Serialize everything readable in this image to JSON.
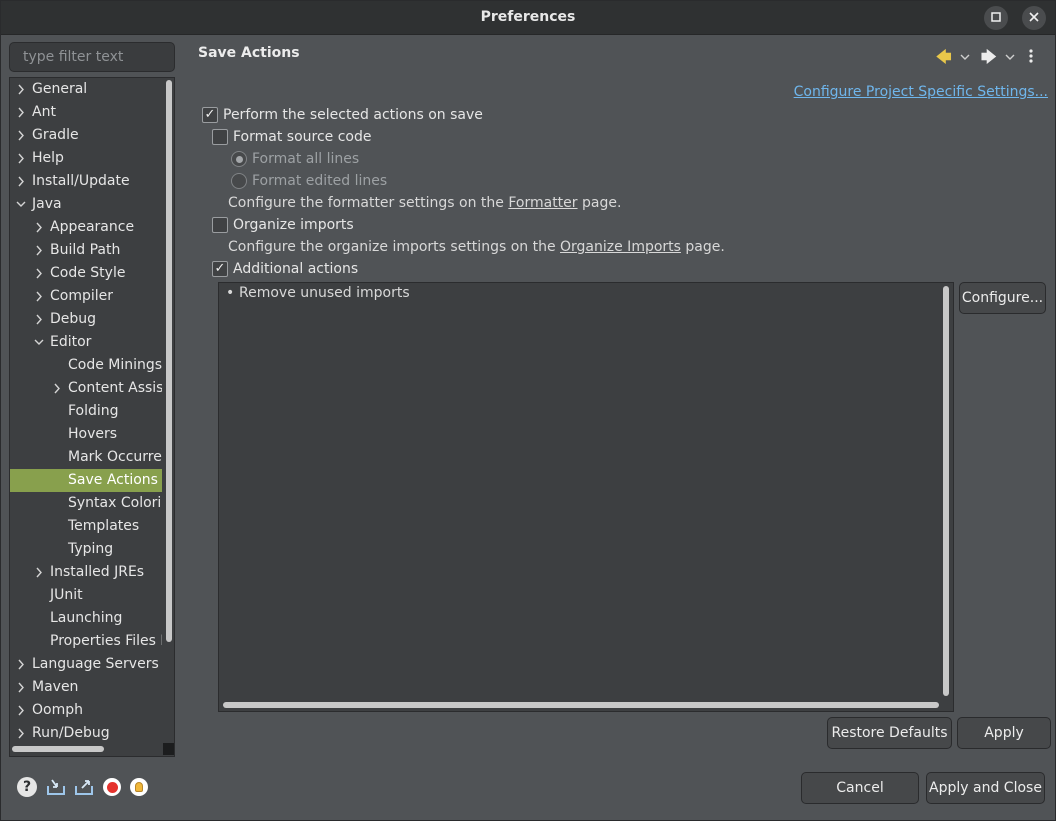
{
  "window": {
    "title": "Preferences",
    "maximize_icon": "maximize-icon",
    "close_icon": "close-icon"
  },
  "filter": {
    "placeholder": "type filter text",
    "value": ""
  },
  "tree": {
    "items": [
      {
        "label": "General",
        "level": 0,
        "expander": "collapsed"
      },
      {
        "label": "Ant",
        "level": 0,
        "expander": "collapsed"
      },
      {
        "label": "Gradle",
        "level": 0,
        "expander": "collapsed"
      },
      {
        "label": "Help",
        "level": 0,
        "expander": "collapsed"
      },
      {
        "label": "Install/Update",
        "level": 0,
        "expander": "collapsed"
      },
      {
        "label": "Java",
        "level": 0,
        "expander": "expanded"
      },
      {
        "label": "Appearance",
        "level": 1,
        "expander": "collapsed"
      },
      {
        "label": "Build Path",
        "level": 1,
        "expander": "collapsed"
      },
      {
        "label": "Code Style",
        "level": 1,
        "expander": "collapsed"
      },
      {
        "label": "Compiler",
        "level": 1,
        "expander": "collapsed"
      },
      {
        "label": "Debug",
        "level": 1,
        "expander": "collapsed"
      },
      {
        "label": "Editor",
        "level": 1,
        "expander": "expanded"
      },
      {
        "label": "Code Minings",
        "level": 2,
        "expander": "none"
      },
      {
        "label": "Content Assist",
        "level": 2,
        "expander": "collapsed"
      },
      {
        "label": "Folding",
        "level": 2,
        "expander": "none"
      },
      {
        "label": "Hovers",
        "level": 2,
        "expander": "none"
      },
      {
        "label": "Mark Occurrences",
        "level": 2,
        "expander": "none"
      },
      {
        "label": "Save Actions",
        "level": 2,
        "expander": "none",
        "selected": true
      },
      {
        "label": "Syntax Coloring",
        "level": 2,
        "expander": "none"
      },
      {
        "label": "Templates",
        "level": 2,
        "expander": "none"
      },
      {
        "label": "Typing",
        "level": 2,
        "expander": "none"
      },
      {
        "label": "Installed JREs",
        "level": 1,
        "expander": "collapsed"
      },
      {
        "label": "JUnit",
        "level": 1,
        "expander": "none"
      },
      {
        "label": "Launching",
        "level": 1,
        "expander": "none"
      },
      {
        "label": "Properties Files Editor",
        "level": 1,
        "expander": "none"
      },
      {
        "label": "Language Servers",
        "level": 0,
        "expander": "collapsed"
      },
      {
        "label": "Maven",
        "level": 0,
        "expander": "collapsed"
      },
      {
        "label": "Oomph",
        "level": 0,
        "expander": "collapsed"
      },
      {
        "label": "Run/Debug",
        "level": 0,
        "expander": "collapsed"
      }
    ]
  },
  "bottom_icons": [
    "help-icon",
    "import-icon",
    "export-icon",
    "record-icon",
    "tip-icon"
  ],
  "page": {
    "title": "Save Actions",
    "nav": {
      "back_icon": "back-arrow-icon",
      "forward_icon": "forward-arrow-icon",
      "menu_icon": "view-menu-icon"
    },
    "config_link": "Configure Project Specific Settings...",
    "perform_on_save": {
      "label": "Perform the selected actions on save",
      "checked": true
    },
    "format_source": {
      "label": "Format source code",
      "checked": false
    },
    "format_all_lines": {
      "label": "Format all lines",
      "selected": true,
      "enabled": false
    },
    "format_edited_lines": {
      "label": "Format edited lines",
      "selected": false,
      "enabled": false
    },
    "formatter_desc": {
      "prefix": "Configure the formatter settings on the ",
      "link": "Formatter",
      "suffix": " page."
    },
    "organize_imports": {
      "label": "Organize imports",
      "checked": false
    },
    "organize_desc": {
      "prefix": "Configure the organize imports settings on the ",
      "link": "Organize Imports",
      "suffix": " page."
    },
    "additional_actions": {
      "label": "Additional actions",
      "checked": true
    },
    "actions_list": [
      {
        "bullet": "•",
        "text": "Remove unused imports"
      }
    ],
    "buttons": {
      "configure": "Configure...",
      "restore_defaults": "Restore Defaults",
      "apply": "Apply",
      "cancel": "Cancel",
      "apply_and_close": "Apply and Close"
    }
  },
  "colors": {
    "selection": "#88a04d",
    "link": "#6fb6ec",
    "background": "#505356"
  }
}
